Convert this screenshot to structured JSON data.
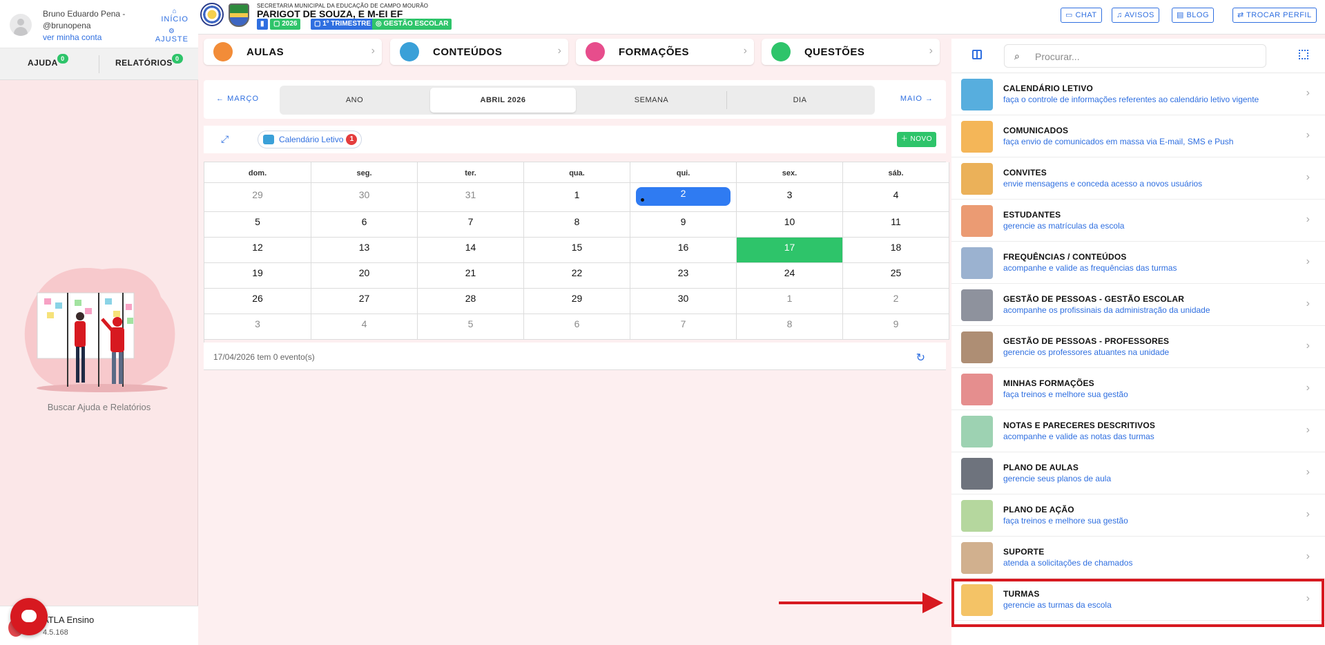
{
  "user": {
    "name": "Bruno Eduardo Pena -",
    "handle": "@brunopena",
    "profile_link": "ver minha conta"
  },
  "left_top_links": {
    "inicio": "INÍCIO",
    "ajuste": "AJUSTE"
  },
  "left_tabs": [
    {
      "label": "AJUDA",
      "count": "0"
    },
    {
      "label": "RELATÓRIOS",
      "count": "0"
    }
  ],
  "help_text": "Buscar Ajuda e Relatórios",
  "app": {
    "name": "ATLA Ensino",
    "version": "4.5.168"
  },
  "header": {
    "secretaria": "SECRETARIA MUNICIPAL DA EDUCAÇÃO DE CAMPO MOURÃO",
    "school": "PARIGOT DE SOUZA, E M-EI EF",
    "badges": [
      {
        "label": "",
        "color": "#2f6fe0"
      },
      {
        "label": "2026",
        "color": "#2ec46a"
      },
      {
        "label": "1º TRIMESTRE",
        "color": "#2f6fe0"
      },
      {
        "label": "GESTÃO ESCOLAR",
        "color": "#2ec46a"
      }
    ],
    "buttons": {
      "chat": "CHAT",
      "avisos": "AVISOS",
      "blog": "BLOG",
      "trocar": "TROCAR PERFIL"
    }
  },
  "categories": [
    {
      "label": "AULAS",
      "color": "#f28c38"
    },
    {
      "label": "CONTEÚDOS",
      "color": "#3aa0d8"
    },
    {
      "label": "FORMAÇÕES",
      "color": "#e74d8c"
    },
    {
      "label": "QUESTÕES",
      "color": "#2ec46a"
    }
  ],
  "calendar_nav": {
    "prev": "MARÇO",
    "next": "MAIO",
    "views": [
      "ANO",
      "ABRIL 2026",
      "SEMANA",
      "DIA"
    ],
    "active_view": "ABRIL 2026"
  },
  "calendar_toolbar": {
    "chip_label": "Calendário Letivo",
    "chip_count": "1",
    "new_label": "NOVO"
  },
  "calendar": {
    "weekdays": [
      "dom.",
      "seg.",
      "ter.",
      "qua.",
      "qui.",
      "sex.",
      "sáb."
    ],
    "weeks": [
      [
        "29",
        "30",
        "31",
        "1",
        "2",
        "3",
        "4"
      ],
      [
        "5",
        "6",
        "7",
        "8",
        "9",
        "10",
        "11"
      ],
      [
        "12",
        "13",
        "14",
        "15",
        "16",
        "17",
        "18"
      ],
      [
        "19",
        "20",
        "21",
        "22",
        "23",
        "24",
        "25"
      ],
      [
        "26",
        "27",
        "28",
        "29",
        "30",
        "1",
        "2"
      ],
      [
        "3",
        "4",
        "5",
        "6",
        "7",
        "8",
        "9"
      ]
    ],
    "selected_day": "2",
    "today": "17",
    "events_text": "17/04/2026 tem 0 evento(s)"
  },
  "search": {
    "placeholder": "Procurar..."
  },
  "menu": [
    {
      "title": "CALENDÁRIO LETIVO",
      "subtitle": "faça o controle de informações referentes ao calendário letivo vigente",
      "icon": "calendar-icon",
      "color": "#3aa0d8"
    },
    {
      "title": "COMUNICADOS",
      "subtitle": "faça envio de comunicados em massa via E-mail, SMS e Push",
      "icon": "envelope-icon",
      "color": "#f2a93b"
    },
    {
      "title": "CONVITES",
      "subtitle": "envie mensagens e conceda acesso a novos usuários",
      "icon": "medal-icon",
      "color": "#e8a33c"
    },
    {
      "title": "ESTUDANTES",
      "subtitle": "gerencie as matrículas da escola",
      "icon": "students-icon",
      "color": "#e88a5a"
    },
    {
      "title": "FREQUÊNCIAS / CONTEÚDOS",
      "subtitle": "acompanhe e valide as frequências das turmas",
      "icon": "clock-checklist-icon",
      "color": "#8aa4c8"
    },
    {
      "title": "GESTÃO DE PESSOAS - GESTÃO ESCOLAR",
      "subtitle": "acompanhe os profissinais da administração da unidade",
      "icon": "people-chart-icon",
      "color": "#7a7f8c"
    },
    {
      "title": "GESTÃO DE PESSOAS - PROFESSORES",
      "subtitle": "gerencie os professores atuantes na unidade",
      "icon": "teachers-icon",
      "color": "#a07a5c"
    },
    {
      "title": "MINHAS FORMAÇÕES",
      "subtitle": "faça treinos e melhore sua gestão",
      "icon": "certificate-icon",
      "color": "#e07a7a"
    },
    {
      "title": "NOTAS E PARECERES DESCRITIVOS",
      "subtitle": "acompanhe e valide as notas das turmas",
      "icon": "grades-icon",
      "color": "#8ccaa4"
    },
    {
      "title": "PLANO DE AULAS",
      "subtitle": "gerencie seus planos de aula",
      "icon": "book-star-icon",
      "color": "#555b66"
    },
    {
      "title": "PLANO DE AÇÃO",
      "subtitle": "faça treinos e melhore sua gestão",
      "icon": "checklist-icon",
      "color": "#a8d08d"
    },
    {
      "title": "SUPORTE",
      "subtitle": "atenda a solicitações de chamados",
      "icon": "support-icon",
      "color": "#c9a27a"
    },
    {
      "title": "TURMAS",
      "subtitle": "gerencie as turmas da escola",
      "icon": "class-book-icon",
      "color": "#f2b84b"
    }
  ],
  "colors": {
    "accent": "#2f6fe0",
    "success": "#2ec46a",
    "danger": "#d71920"
  }
}
